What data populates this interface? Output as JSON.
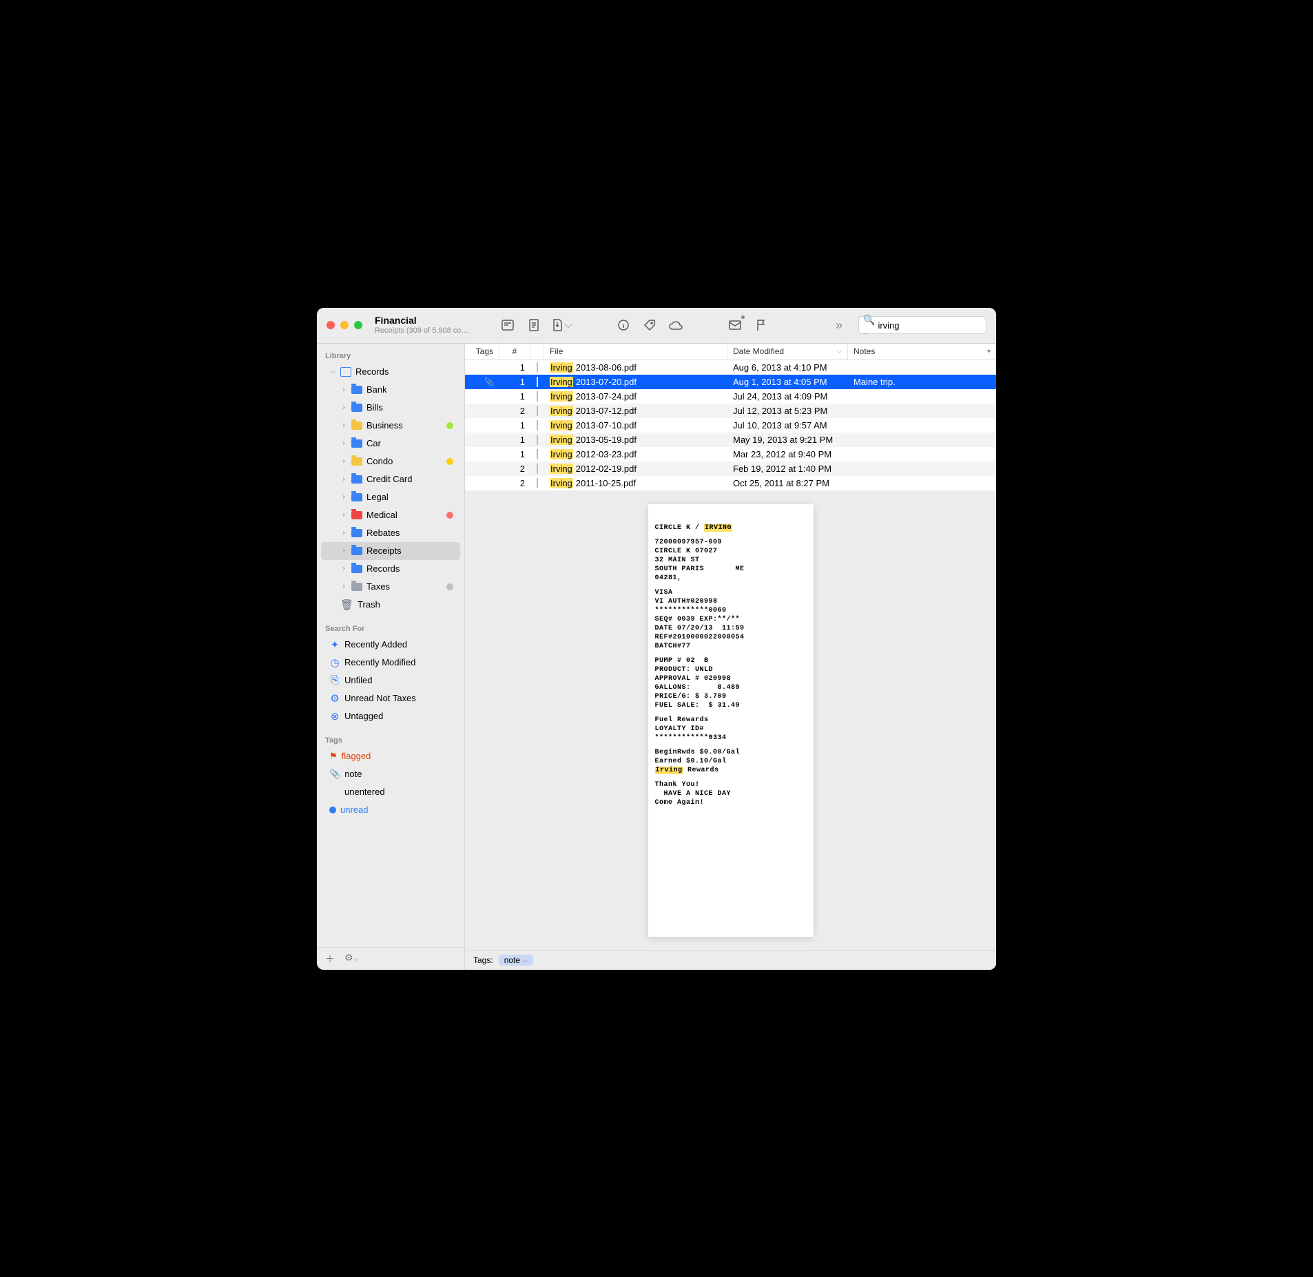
{
  "window": {
    "title": "Financial",
    "subtitle": "Receipts (309 of 5,908 co…"
  },
  "search": {
    "value": "irving"
  },
  "sidebar": {
    "section_library": "Library",
    "records_root": "Records",
    "folders": [
      {
        "label": "Bank",
        "color": "blue"
      },
      {
        "label": "Bills",
        "color": "blue"
      },
      {
        "label": "Business",
        "color": "yellow",
        "badge": "green"
      },
      {
        "label": "Car",
        "color": "blue"
      },
      {
        "label": "Condo",
        "color": "yellow",
        "badge": "yellow"
      },
      {
        "label": "Credit Card",
        "color": "blue"
      },
      {
        "label": "Legal",
        "color": "blue"
      },
      {
        "label": "Medical",
        "color": "red",
        "badge": "red"
      },
      {
        "label": "Rebates",
        "color": "blue"
      },
      {
        "label": "Receipts",
        "color": "blue",
        "selected": true
      },
      {
        "label": "Records",
        "color": "blue"
      },
      {
        "label": "Taxes",
        "color": "gray",
        "badge": "gray"
      }
    ],
    "trash": "Trash",
    "section_search": "Search For",
    "smart": [
      {
        "label": "Recently Added",
        "icon": "✦"
      },
      {
        "label": "Recently Modified",
        "icon": "◷"
      },
      {
        "label": "Unfiled",
        "icon": "⎘"
      },
      {
        "label": "Unread Not Taxes",
        "icon": "⚙"
      },
      {
        "label": "Untagged",
        "icon": "⊗"
      }
    ],
    "section_tags": "Tags",
    "tags": [
      {
        "label": "flagged",
        "cls": "flagged",
        "icon": "⚑"
      },
      {
        "label": "note",
        "cls": "",
        "icon": "📎"
      },
      {
        "label": "unentered",
        "cls": "",
        "icon": ""
      },
      {
        "label": "unread",
        "cls": "unread",
        "icon": "●"
      }
    ]
  },
  "columns": {
    "tags": "Tags",
    "num": "#",
    "file": "File",
    "date": "Date Modified",
    "notes": "Notes"
  },
  "rows": [
    {
      "tags": "",
      "num": "1",
      "hl": "Irving",
      "rest": " 2013-08-06.pdf",
      "date": "Aug 6, 2013 at 4:10 PM",
      "notes": ""
    },
    {
      "tags": "clip",
      "num": "1",
      "hl": "Irving",
      "rest": " 2013-07-20.pdf",
      "date": "Aug 1, 2013 at 4:05 PM",
      "notes": "Maine trip.",
      "selected": true
    },
    {
      "tags": "",
      "num": "1",
      "hl": "Irving",
      "rest": " 2013-07-24.pdf",
      "date": "Jul 24, 2013 at 4:09 PM",
      "notes": ""
    },
    {
      "tags": "",
      "num": "2",
      "hl": "Irving",
      "rest": " 2013-07-12.pdf",
      "date": "Jul 12, 2013 at 5:23 PM",
      "notes": ""
    },
    {
      "tags": "",
      "num": "1",
      "hl": "Irving",
      "rest": " 2013-07-10.pdf",
      "date": "Jul 10, 2013 at 9:57 AM",
      "notes": ""
    },
    {
      "tags": "",
      "num": "1",
      "hl": "Irving",
      "rest": " 2013-05-19.pdf",
      "date": "May 19, 2013 at 9:21 PM",
      "notes": ""
    },
    {
      "tags": "",
      "num": "1",
      "hl": "Irving",
      "rest": " 2012-03-23.pdf",
      "date": "Mar 23, 2012 at 9:40 PM",
      "notes": ""
    },
    {
      "tags": "",
      "num": "2",
      "hl": "Irving",
      "rest": " 2012-02-19.pdf",
      "date": "Feb 19, 2012 at 1:40 PM",
      "notes": ""
    },
    {
      "tags": "",
      "num": "2",
      "hl": "Irving",
      "rest": " 2011-10-25.pdf",
      "date": "Oct 25, 2011 at 8:27 PM",
      "notes": ""
    }
  ],
  "receipt": {
    "l1a": "CIRCLE K / ",
    "l1b": "IRVING",
    "l2": "72000097957-009",
    "l3": "CIRCLE K 07027",
    "l4": "32 MAIN ST",
    "l5": "SOUTH PARIS       ME",
    "l6": "04281,",
    "l7": "VISA",
    "l8": "VI AUTH#020998",
    "l9": "************0060",
    "l10": "SEQ# 0039 EXP:**/**",
    "l11": "DATE 07/20/13  11:59",
    "l12": "REF#2010000022000054",
    "l13": "BATCH#77",
    "l14": "PUMP # 02  B",
    "l15": "PRODUCT: UNLD",
    "l16": "APPROVAL # 020998",
    "l17": "GALLONS:      8.489",
    "l18": "PRICE/G: $ 3.709",
    "l19": "FUEL SALE:  $ 31.49",
    "l20": "Fuel Rewards",
    "l21": "LOYALTY ID#",
    "l22": "************9334",
    "l23": "BeginRwds $0.00/Gal",
    "l24": "Earned $0.10/Gal",
    "l25a": "Irving",
    "l25b": " Rewards",
    "l26": "Thank You!",
    "l27": "  HAVE A NICE DAY",
    "l28": "Come Again!"
  },
  "statusbar": {
    "label": "Tags:",
    "tag": "note"
  }
}
